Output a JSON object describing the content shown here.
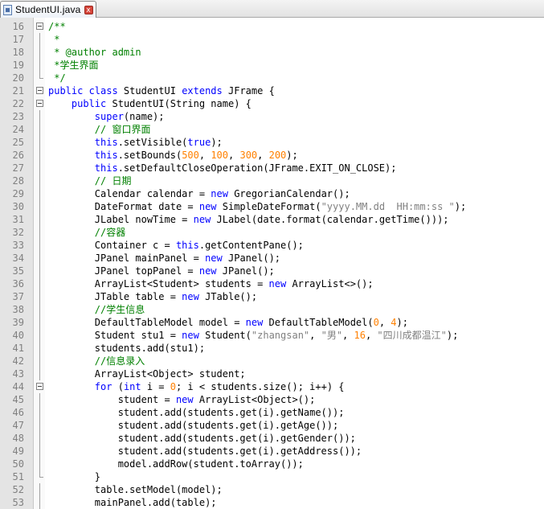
{
  "tab": {
    "filename": "StudentUI.java",
    "file_icon": "java-file-icon",
    "close_icon": "close-icon",
    "close_glyph": "x"
  },
  "lines": [
    {
      "no": "16",
      "fold": "open",
      "segs": [
        [
          "cm",
          "/**"
        ]
      ]
    },
    {
      "no": "17",
      "fold": "line",
      "segs": [
        [
          "cm",
          " *"
        ]
      ]
    },
    {
      "no": "18",
      "fold": "line",
      "segs": [
        [
          "cm",
          " * @author admin"
        ]
      ]
    },
    {
      "no": "19",
      "fold": "line",
      "segs": [
        [
          "cm",
          " *学生界面"
        ]
      ]
    },
    {
      "no": "20",
      "fold": "end",
      "segs": [
        [
          "cm",
          " */"
        ]
      ]
    },
    {
      "no": "21",
      "fold": "open",
      "segs": [
        [
          "kw",
          "public class"
        ],
        [
          "p",
          " StudentUI "
        ],
        [
          "kw",
          "extends"
        ],
        [
          "p",
          " JFrame {"
        ]
      ]
    },
    {
      "no": "22",
      "fold": "open",
      "segs": [
        [
          "p",
          "    "
        ],
        [
          "kw",
          "public"
        ],
        [
          "p",
          " StudentUI(String name) {"
        ]
      ]
    },
    {
      "no": "23",
      "fold": "line",
      "segs": [
        [
          "p",
          "        "
        ],
        [
          "kw",
          "super"
        ],
        [
          "p",
          "(name);"
        ]
      ]
    },
    {
      "no": "24",
      "fold": "line",
      "segs": [
        [
          "p",
          "        "
        ],
        [
          "cm",
          "// 窗口界面"
        ]
      ]
    },
    {
      "no": "25",
      "fold": "line",
      "segs": [
        [
          "p",
          "        "
        ],
        [
          "kw",
          "this"
        ],
        [
          "p",
          ".setVisible("
        ],
        [
          "kw",
          "true"
        ],
        [
          "p",
          ");"
        ]
      ]
    },
    {
      "no": "26",
      "fold": "line",
      "segs": [
        [
          "p",
          "        "
        ],
        [
          "kw",
          "this"
        ],
        [
          "p",
          ".setBounds("
        ],
        [
          "num",
          "500"
        ],
        [
          "p",
          ", "
        ],
        [
          "num",
          "100"
        ],
        [
          "p",
          ", "
        ],
        [
          "num",
          "300"
        ],
        [
          "p",
          ", "
        ],
        [
          "num",
          "200"
        ],
        [
          "p",
          ");"
        ]
      ]
    },
    {
      "no": "27",
      "fold": "line",
      "segs": [
        [
          "p",
          "        "
        ],
        [
          "kw",
          "this"
        ],
        [
          "p",
          ".setDefaultCloseOperation(JFrame.EXIT_ON_CLOSE);"
        ]
      ]
    },
    {
      "no": "28",
      "fold": "line",
      "segs": [
        [
          "p",
          "        "
        ],
        [
          "cm",
          "// 日期"
        ]
      ]
    },
    {
      "no": "29",
      "fold": "line",
      "segs": [
        [
          "p",
          "        Calendar calendar = "
        ],
        [
          "kw",
          "new"
        ],
        [
          "p",
          " GregorianCalendar();"
        ]
      ]
    },
    {
      "no": "30",
      "fold": "line",
      "segs": [
        [
          "p",
          "        DateFormat date = "
        ],
        [
          "kw",
          "new"
        ],
        [
          "p",
          " SimpleDateFormat("
        ],
        [
          "str",
          "\"yyyy.MM.dd  HH:mm:ss \""
        ],
        [
          "p",
          ");"
        ]
      ]
    },
    {
      "no": "31",
      "fold": "line",
      "segs": [
        [
          "p",
          "        JLabel nowTime = "
        ],
        [
          "kw",
          "new"
        ],
        [
          "p",
          " JLabel(date.format(calendar.getTime()));"
        ]
      ]
    },
    {
      "no": "32",
      "fold": "line",
      "segs": [
        [
          "p",
          "        "
        ],
        [
          "cm",
          "//容器"
        ]
      ]
    },
    {
      "no": "33",
      "fold": "line",
      "segs": [
        [
          "p",
          "        Container c = "
        ],
        [
          "kw",
          "this"
        ],
        [
          "p",
          ".getContentPane();"
        ]
      ]
    },
    {
      "no": "34",
      "fold": "line",
      "segs": [
        [
          "p",
          "        JPanel mainPanel = "
        ],
        [
          "kw",
          "new"
        ],
        [
          "p",
          " JPanel();"
        ]
      ]
    },
    {
      "no": "35",
      "fold": "line",
      "segs": [
        [
          "p",
          "        JPanel topPanel = "
        ],
        [
          "kw",
          "new"
        ],
        [
          "p",
          " JPanel();"
        ]
      ]
    },
    {
      "no": "36",
      "fold": "line",
      "segs": [
        [
          "p",
          "        ArrayList<Student> students = "
        ],
        [
          "kw",
          "new"
        ],
        [
          "p",
          " ArrayList<>();"
        ]
      ]
    },
    {
      "no": "37",
      "fold": "line",
      "segs": [
        [
          "p",
          "        JTable table = "
        ],
        [
          "kw",
          "new"
        ],
        [
          "p",
          " JTable();"
        ]
      ]
    },
    {
      "no": "38",
      "fold": "line",
      "segs": [
        [
          "p",
          "        "
        ],
        [
          "cm",
          "//学生信息"
        ]
      ]
    },
    {
      "no": "39",
      "fold": "line",
      "segs": [
        [
          "p",
          "        DefaultTableModel model = "
        ],
        [
          "kw",
          "new"
        ],
        [
          "p",
          " DefaultTableModel("
        ],
        [
          "num",
          "0"
        ],
        [
          "p",
          ", "
        ],
        [
          "num",
          "4"
        ],
        [
          "p",
          ");"
        ]
      ]
    },
    {
      "no": "40",
      "fold": "line",
      "segs": [
        [
          "p",
          "        Student stu1 = "
        ],
        [
          "kw",
          "new"
        ],
        [
          "p",
          " Student("
        ],
        [
          "str",
          "\"zhangsan\""
        ],
        [
          "p",
          ", "
        ],
        [
          "str",
          "\"男\""
        ],
        [
          "p",
          ", "
        ],
        [
          "num",
          "16"
        ],
        [
          "p",
          ", "
        ],
        [
          "str",
          "\"四川成都温江\""
        ],
        [
          "p",
          ");"
        ]
      ]
    },
    {
      "no": "41",
      "fold": "line",
      "segs": [
        [
          "p",
          "        students.add(stu1);"
        ]
      ]
    },
    {
      "no": "42",
      "fold": "line",
      "segs": [
        [
          "p",
          "        "
        ],
        [
          "cm",
          "//信息录入"
        ]
      ]
    },
    {
      "no": "43",
      "fold": "line",
      "segs": [
        [
          "p",
          "        ArrayList<Object> student;"
        ]
      ]
    },
    {
      "no": "44",
      "fold": "open",
      "segs": [
        [
          "p",
          "        "
        ],
        [
          "kw",
          "for"
        ],
        [
          "p",
          " ("
        ],
        [
          "kw",
          "int"
        ],
        [
          "p",
          " i = "
        ],
        [
          "num",
          "0"
        ],
        [
          "p",
          "; i < students.size(); i++) {"
        ]
      ]
    },
    {
      "no": "45",
      "fold": "line",
      "segs": [
        [
          "p",
          "            student = "
        ],
        [
          "kw",
          "new"
        ],
        [
          "p",
          " ArrayList<Object>();"
        ]
      ]
    },
    {
      "no": "46",
      "fold": "line",
      "segs": [
        [
          "p",
          "            student.add(students.get(i).getName());"
        ]
      ]
    },
    {
      "no": "47",
      "fold": "line",
      "segs": [
        [
          "p",
          "            student.add(students.get(i).getAge());"
        ]
      ]
    },
    {
      "no": "48",
      "fold": "line",
      "segs": [
        [
          "p",
          "            student.add(students.get(i).getGender());"
        ]
      ]
    },
    {
      "no": "49",
      "fold": "line",
      "segs": [
        [
          "p",
          "            student.add(students.get(i).getAddress());"
        ]
      ]
    },
    {
      "no": "50",
      "fold": "line",
      "segs": [
        [
          "p",
          "            model.addRow(student.toArray());"
        ]
      ]
    },
    {
      "no": "51",
      "fold": "end",
      "segs": [
        [
          "p",
          "        }"
        ]
      ]
    },
    {
      "no": "52",
      "fold": "line",
      "segs": [
        [
          "p",
          "        table.setModel(model);"
        ]
      ]
    },
    {
      "no": "53",
      "fold": "line",
      "segs": [
        [
          "p",
          "        mainPanel.add(table);"
        ]
      ]
    }
  ]
}
